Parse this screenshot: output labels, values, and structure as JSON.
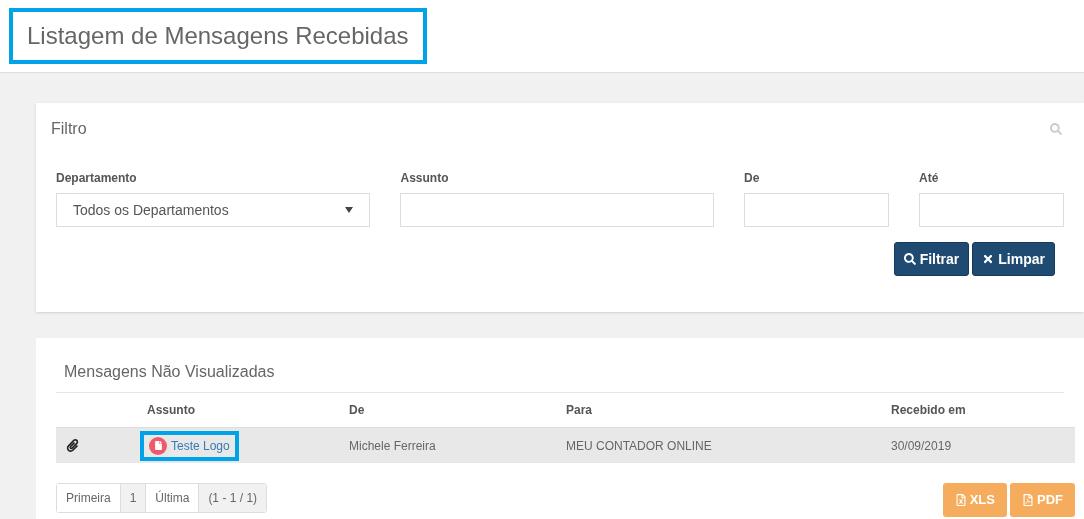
{
  "page_title": "Listagem de Mensagens Recebidas",
  "filter": {
    "title": "Filtro",
    "fields": [
      {
        "kind": "select",
        "label": "Departamento",
        "value": "Todos os Departamentos"
      },
      {
        "kind": "text",
        "label": "Assunto"
      },
      {
        "kind": "text",
        "label": "De"
      },
      {
        "kind": "text",
        "label": "Até"
      }
    ],
    "buttons": [
      {
        "kind": "search",
        "label": "Filtrar"
      },
      {
        "kind": "clear",
        "label": "Limpar"
      }
    ]
  },
  "messages": {
    "title": "Mensagens Não Visualizadas",
    "columns": [
      "Assunto",
      "De",
      "Para",
      "Recebido em"
    ],
    "rows": [
      {
        "attachment": true,
        "subject": "Teste Logo",
        "from": "Michele Ferreira",
        "to": "MEU CONTADOR ONLINE",
        "received": "30/09/2019"
      }
    ],
    "pagination": [
      {
        "kind": "link",
        "label": "Primeira"
      },
      {
        "kind": "page",
        "label": "1",
        "selected": true
      },
      {
        "kind": "link",
        "label": "Última"
      },
      {
        "kind": "info",
        "label": "(1 - 1 / 1)"
      }
    ],
    "exports": [
      {
        "kind": "xls",
        "label": "XLS"
      },
      {
        "kind": "pdf",
        "label": "PDF"
      }
    ]
  }
}
